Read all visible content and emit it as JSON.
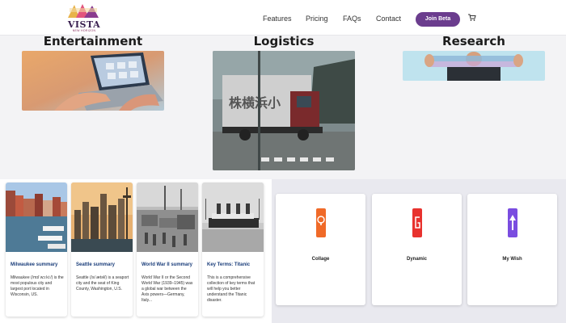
{
  "brand": {
    "name": "VISTA",
    "tagline": "NEW HORIZON"
  },
  "nav": [
    {
      "label": "Features"
    },
    {
      "label": "Pricing"
    },
    {
      "label": "FAQs"
    },
    {
      "label": "Contact"
    }
  ],
  "cta": {
    "label": "Join Beta"
  },
  "categories": [
    {
      "title": "Entertainment"
    },
    {
      "title": "Logistics"
    },
    {
      "title": "Research"
    }
  ],
  "cards": [
    {
      "title": "Milwaukee summary",
      "desc": "Milwaukee (/mɪlˈwɔːkiː/) is the most populous city and largest port located in Wisconsin, US."
    },
    {
      "title": "Seattle summary",
      "desc": "Seattle (/siˈætəl/) is a seaport city and the seat of King County, Washington, U.S."
    },
    {
      "title": "World War II summary",
      "desc": "World War II or the Second World War (1939–1945) was a global war between the Axis powers—Germany, Italy..."
    },
    {
      "title": "Key Terms: Titanic",
      "desc": "This is a comprehensive collection of key terms that will help you better understand the Titanic disaster."
    }
  ],
  "apps": [
    {
      "name": "Collage",
      "color": "#f06a28"
    },
    {
      "name": "Dynamic",
      "color": "#e8322e"
    },
    {
      "name": "My Wish",
      "color": "#7a4de0"
    }
  ],
  "colors": {
    "accent": "#6b3d8e",
    "card_title": "#1a3d7a"
  }
}
